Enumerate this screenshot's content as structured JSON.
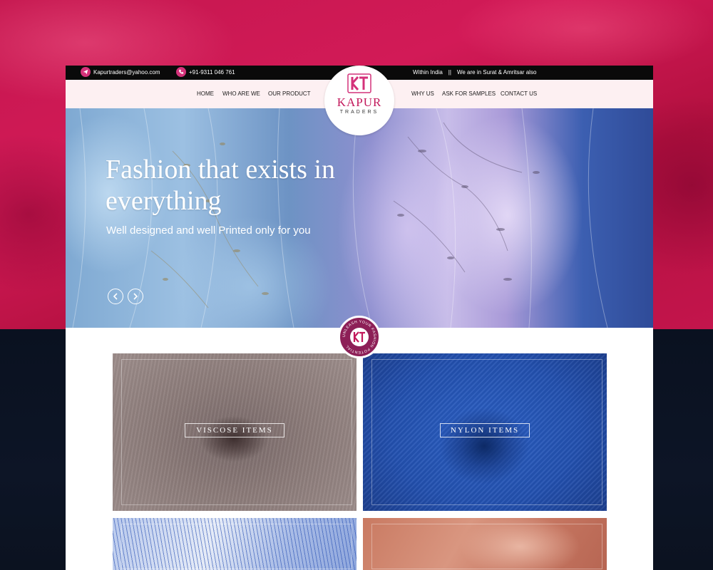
{
  "topbar": {
    "email": "Kapurtraders@yahoo.com",
    "phone": "+91-9311 046 761",
    "region": "Within India",
    "separator": "||",
    "locations": "We are in Surat & Amritsar also"
  },
  "nav": {
    "left": [
      "HOME",
      "WHO ARE WE",
      "OUR PRODUCT"
    ],
    "right": [
      "WHY US",
      "ASK FOR SAMPLES",
      "CONTACT US"
    ]
  },
  "logo": {
    "monogram": "KT",
    "name": "KAPUR",
    "tagline": "TRADERS"
  },
  "hero": {
    "title": "Fashion that exists in everything",
    "subtitle": "Well designed and well Printed only for you",
    "slides": 4,
    "active_slide": 2
  },
  "badge": {
    "text": "UNLEASH YOUR FASHION POTENTIAL",
    "monogram": "KT"
  },
  "products": [
    {
      "label": "VISCOSE ITEMS"
    },
    {
      "label": "NYLON ITEMS"
    }
  ],
  "colors": {
    "brand_pink": "#d4327a",
    "badge_purple": "#8d1f57",
    "nav_bg": "#fdf0f2"
  },
  "icons": [
    "telegram-icon",
    "phone-icon",
    "chevron-left-icon",
    "chevron-right-icon"
  ]
}
